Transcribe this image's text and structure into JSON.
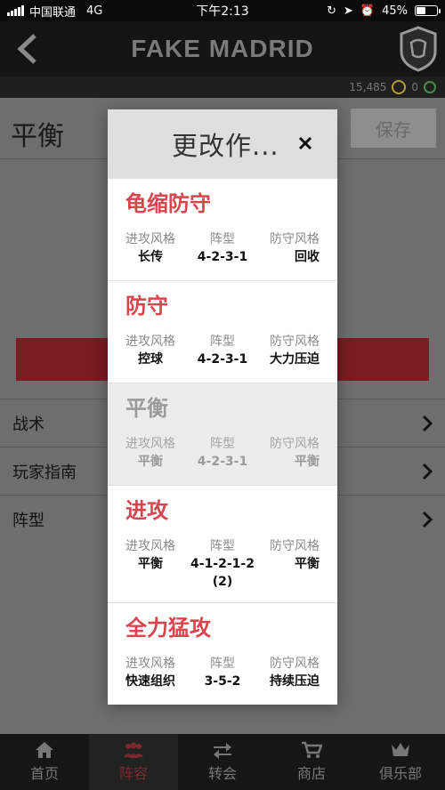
{
  "status_bar": {
    "carrier": "中国联通",
    "network": "4G",
    "time": "下午2:13",
    "battery": "45%",
    "battery_level": 0.45
  },
  "header": {
    "club_name": "FAKE MADRID",
    "coins": "15,485",
    "points": "0"
  },
  "page": {
    "title": "平衡",
    "save_label": "保存",
    "menu": [
      "战术",
      "玩家指南",
      "阵型"
    ]
  },
  "modal": {
    "title": "更改作...",
    "column_labels": {
      "attack": "进攻风格",
      "formation": "阵型",
      "defense": "防守风格"
    },
    "options": [
      {
        "name": "龟缩防守",
        "attack": "长传",
        "formation": "4-2-3-1",
        "defense": "回收",
        "selected": false
      },
      {
        "name": "防守",
        "attack": "控球",
        "formation": "4-2-3-1",
        "defense": "大力压迫",
        "selected": false
      },
      {
        "name": "平衡",
        "attack": "平衡",
        "formation": "4-2-3-1",
        "defense": "平衡",
        "selected": true
      },
      {
        "name": "进攻",
        "attack": "平衡",
        "formation": "4-1-2-1-2 (2)",
        "defense": "平衡",
        "selected": false
      },
      {
        "name": "全力猛攻",
        "attack": "快速组织",
        "formation": "3-5-2",
        "defense": "持续压迫",
        "selected": false
      }
    ]
  },
  "bottom_nav": {
    "items": [
      {
        "label": "首页",
        "icon": "home-icon",
        "active": false
      },
      {
        "label": "阵容",
        "icon": "squad-icon",
        "active": true
      },
      {
        "label": "转会",
        "icon": "transfer-icon",
        "active": false
      },
      {
        "label": "商店",
        "icon": "cart-icon",
        "active": false
      },
      {
        "label": "俱乐部",
        "icon": "club-icon",
        "active": false
      }
    ]
  },
  "colors": {
    "accent_red": "#d9454d",
    "header_bg": "#141414",
    "modal_header_bg": "#dedede"
  }
}
